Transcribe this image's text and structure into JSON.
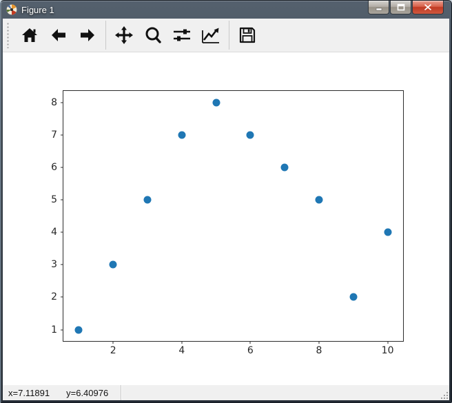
{
  "window": {
    "title": "Figure 1",
    "icon": "matplotlib-logo-icon",
    "controls": [
      {
        "name": "minimize"
      },
      {
        "name": "maximize"
      },
      {
        "name": "close"
      }
    ]
  },
  "toolbar": {
    "buttons": [
      {
        "name": "home",
        "icon": "home-icon"
      },
      {
        "name": "back",
        "icon": "back-arrow-icon"
      },
      {
        "name": "forward",
        "icon": "forward-arrow-icon"
      },
      {
        "name": "pan",
        "icon": "pan-arrows-icon"
      },
      {
        "name": "zoom",
        "icon": "magnifier-icon"
      },
      {
        "name": "configure-subplots",
        "icon": "sliders-icon"
      },
      {
        "name": "edit-parameters",
        "icon": "line-chart-icon"
      },
      {
        "name": "save",
        "icon": "floppy-disk-icon"
      }
    ]
  },
  "statusbar": {
    "x_coordinate": "x=7.11891",
    "y_coordinate": "y=6.40976"
  },
  "chart_data": {
    "type": "scatter",
    "x": [
      1,
      2,
      3,
      4,
      5,
      6,
      7,
      8,
      9,
      10
    ],
    "y": [
      1,
      3,
      5,
      7,
      8,
      7,
      6,
      5,
      2,
      4
    ],
    "marker_color": "#1f77b4",
    "title": "",
    "xlabel": "",
    "ylabel": "",
    "xticks": [
      2,
      4,
      6,
      8,
      10
    ],
    "yticks": [
      1,
      2,
      3,
      4,
      5,
      6,
      7,
      8
    ],
    "xlim": [
      0.55,
      10.45
    ],
    "ylim": [
      0.65,
      8.35
    ],
    "grid": false,
    "legend": null
  }
}
